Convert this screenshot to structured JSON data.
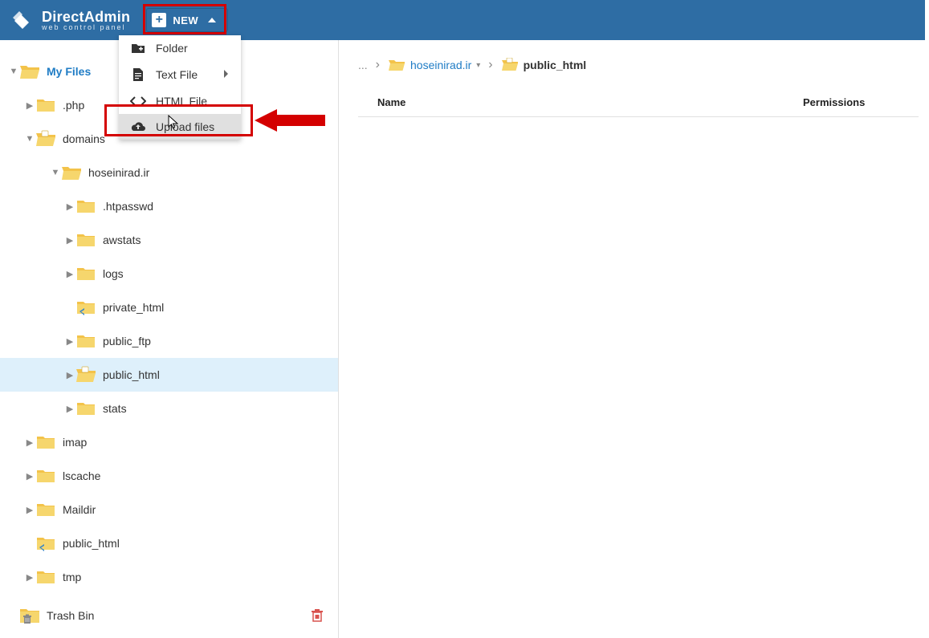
{
  "brand": {
    "name": "DirectAdmin",
    "subtitle": "web control panel"
  },
  "new_button": {
    "label": "NEW"
  },
  "dropdown": {
    "folder": "Folder",
    "text_file": "Text File",
    "html_file": "HTML File",
    "upload_files": "Upload files"
  },
  "breadcrumb": {
    "dots": "...",
    "domain": "hoseinirad.ir",
    "current": "public_html"
  },
  "table": {
    "name_header": "Name",
    "perm_header": "Permissions"
  },
  "tree": {
    "root": "My Files",
    "php": ".php",
    "domains": "domains",
    "hoseinirad": "hoseinirad.ir",
    "htpasswd": ".htpasswd",
    "awstats": "awstats",
    "logs": "logs",
    "private_html": "private_html",
    "public_ftp": "public_ftp",
    "public_html": "public_html",
    "stats": "stats",
    "imap": "imap",
    "lscache": "lscache",
    "maildir": "Maildir",
    "public_html2": "public_html",
    "tmp": "tmp",
    "trash": "Trash Bin"
  }
}
